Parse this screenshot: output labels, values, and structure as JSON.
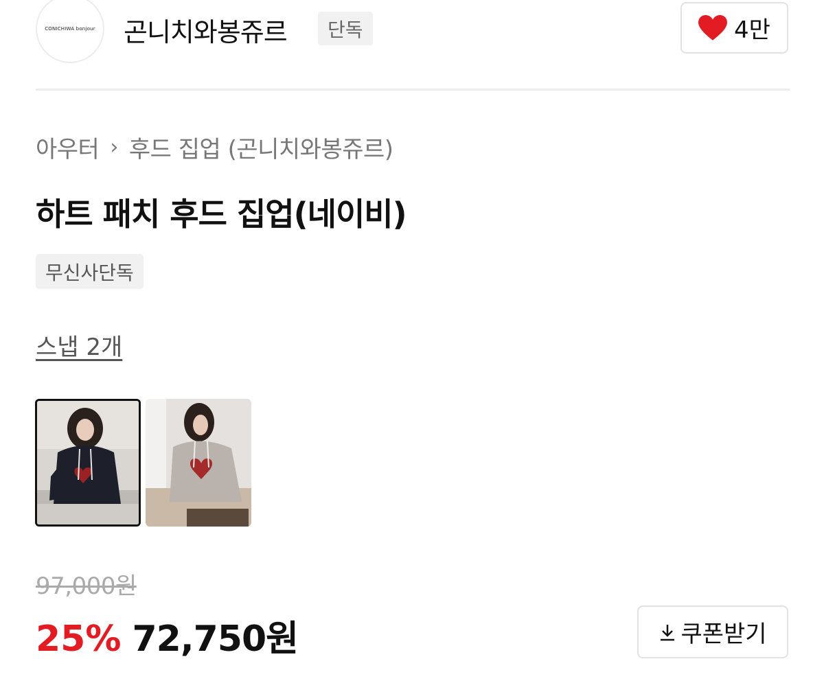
{
  "brand": {
    "logo_text": "CONICHIWA bonjour",
    "name": "곤니치와봉쥬르",
    "badge": "단독",
    "like_count": "4만",
    "like_color": "#e31b23"
  },
  "breadcrumb": {
    "category": "아우터",
    "separator_icon": "chevron-right-icon",
    "subcategory": "후드 집업 (곤니치와봉쥬르)"
  },
  "product": {
    "title": "하트 패치 후드 집업(네이비)",
    "tag": "무신사단독"
  },
  "snap": {
    "label": "스냅 2개",
    "thumbnails": [
      {
        "selected": true
      },
      {
        "selected": false
      }
    ]
  },
  "price": {
    "original": "97,000원",
    "discount": "25%",
    "sale": "72,750원",
    "discount_color": "#e31b23"
  },
  "coupon": {
    "icon": "download-icon",
    "label": "쿠폰받기"
  }
}
